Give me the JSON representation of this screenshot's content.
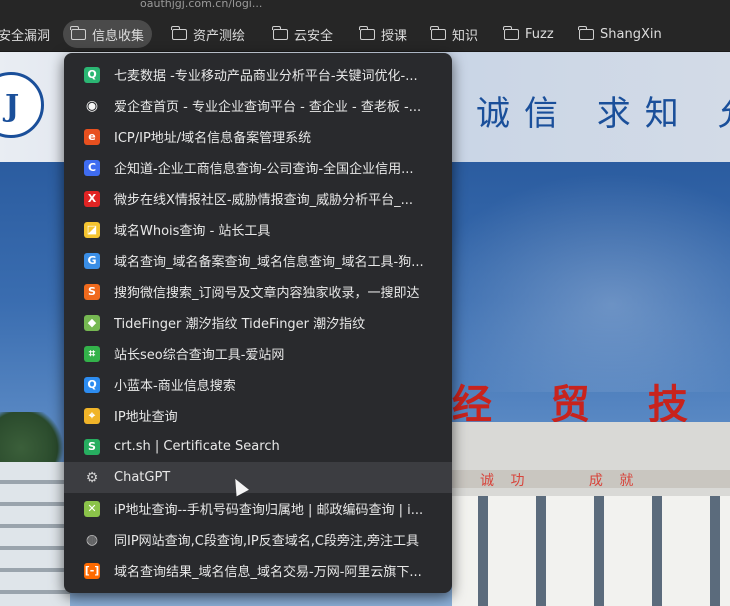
{
  "browser": {
    "url_fragment": "oauthjgj.com.cn/logi..."
  },
  "bookmarks_bar": [
    {
      "label": "安全漏洞",
      "name": "bookmark-anquanloudong",
      "active": false
    },
    {
      "label": "信息收集",
      "name": "bookmark-xinxishouji",
      "active": true
    },
    {
      "label": "资产测绘",
      "name": "bookmark-zichancehui",
      "active": false
    },
    {
      "label": "云安全",
      "name": "bookmark-yunanquan",
      "active": false
    },
    {
      "label": "授课",
      "name": "bookmark-shouke",
      "active": false
    },
    {
      "label": "知识",
      "name": "bookmark-zhishi",
      "active": false
    },
    {
      "label": "Fuzz",
      "name": "bookmark-fuzz",
      "active": false
    },
    {
      "label": "ShangXin",
      "name": "bookmark-shangxin",
      "active": false
    }
  ],
  "background_site": {
    "motto": "诚信 求知 允",
    "building_sign": "经 贸 技 师",
    "small_signs": [
      "诚 功",
      "成 就"
    ]
  },
  "dropdown": {
    "items": [
      {
        "label": "七麦数据 -专业移动产品商业分析平台-关键词优化-...",
        "icon": "qimai-icon",
        "icon_color": "#2bb673",
        "glyph": "Q"
      },
      {
        "label": "爱企查首页 - 专业企业查询平台 - 查企业 - 查老板 -...",
        "icon": "aiqicha-icon",
        "icon_color": "#f5f5f5",
        "glyph": "◉"
      },
      {
        "label": "ICP/IP地址/域名信息备案管理系统",
        "icon": "miit-icon",
        "icon_color": "#e8501f",
        "glyph": "e"
      },
      {
        "label": "企知道-企业工商信息查询-公司查询-全国企业信用...",
        "icon": "qizhidao-icon",
        "icon_color": "#3f6cf0",
        "glyph": "C"
      },
      {
        "label": "微步在线X情报社区-威胁情报查询_威胁分析平台_...",
        "icon": "threatbook-icon",
        "icon_color": "#e02424",
        "glyph": "X"
      },
      {
        "label": "域名Whois查询 - 站长工具",
        "icon": "chinaz-icon",
        "icon_color": "#f4c430",
        "glyph": "◪"
      },
      {
        "label": "域名查询_域名备案查询_域名信息查询_域名工具-狗...",
        "icon": "gogoaa-icon",
        "icon_color": "#3a8ee6",
        "glyph": "G"
      },
      {
        "label": "搜狗微信搜索_订阅号及文章内容独家收录，一搜即达",
        "icon": "sogou-icon",
        "icon_color": "#f06a1d",
        "glyph": "S"
      },
      {
        "label": "TideFinger 潮汐指纹 TideFinger 潮汐指纹",
        "icon": "tidefinger-icon",
        "icon_color": "#76b852",
        "glyph": "◆"
      },
      {
        "label": "站长seo综合查询工具-爱站网",
        "icon": "aizhan-icon",
        "icon_color": "#33b24a",
        "glyph": "⌗"
      },
      {
        "label": "小蓝本-商业信息搜索",
        "icon": "xiaolanben-icon",
        "icon_color": "#2d8cf0",
        "glyph": "Q"
      },
      {
        "label": "IP地址查询",
        "icon": "ip-location-icon",
        "icon_color": "#f0b429",
        "glyph": "⌖"
      },
      {
        "label": "crt.sh | Certificate Search",
        "icon": "crtsh-icon",
        "icon_color": "#27ae60",
        "glyph": "S"
      },
      {
        "label": "ChatGPT",
        "icon": "chatgpt-icon",
        "icon_color": "#cfcfcf",
        "glyph": "⚙"
      },
      {
        "label": "iP地址查询--手机号码查询归属地 | 邮政编码查询 | i...",
        "icon": "ip138-icon",
        "icon_color": "#8bc34a",
        "glyph": "✕"
      },
      {
        "label": "同IP网站查询,C段查询,IP反查域名,C段旁注,旁注工具",
        "icon": "globe-icon",
        "icon_color": "#bdbdbd",
        "glyph": "◍"
      },
      {
        "label": "域名查询结果_域名信息_域名交易-万网-阿里云旗下...",
        "icon": "aliyun-icon",
        "icon_color": "#ff6a00",
        "glyph": "[-]"
      }
    ],
    "hovered_index": 13
  }
}
